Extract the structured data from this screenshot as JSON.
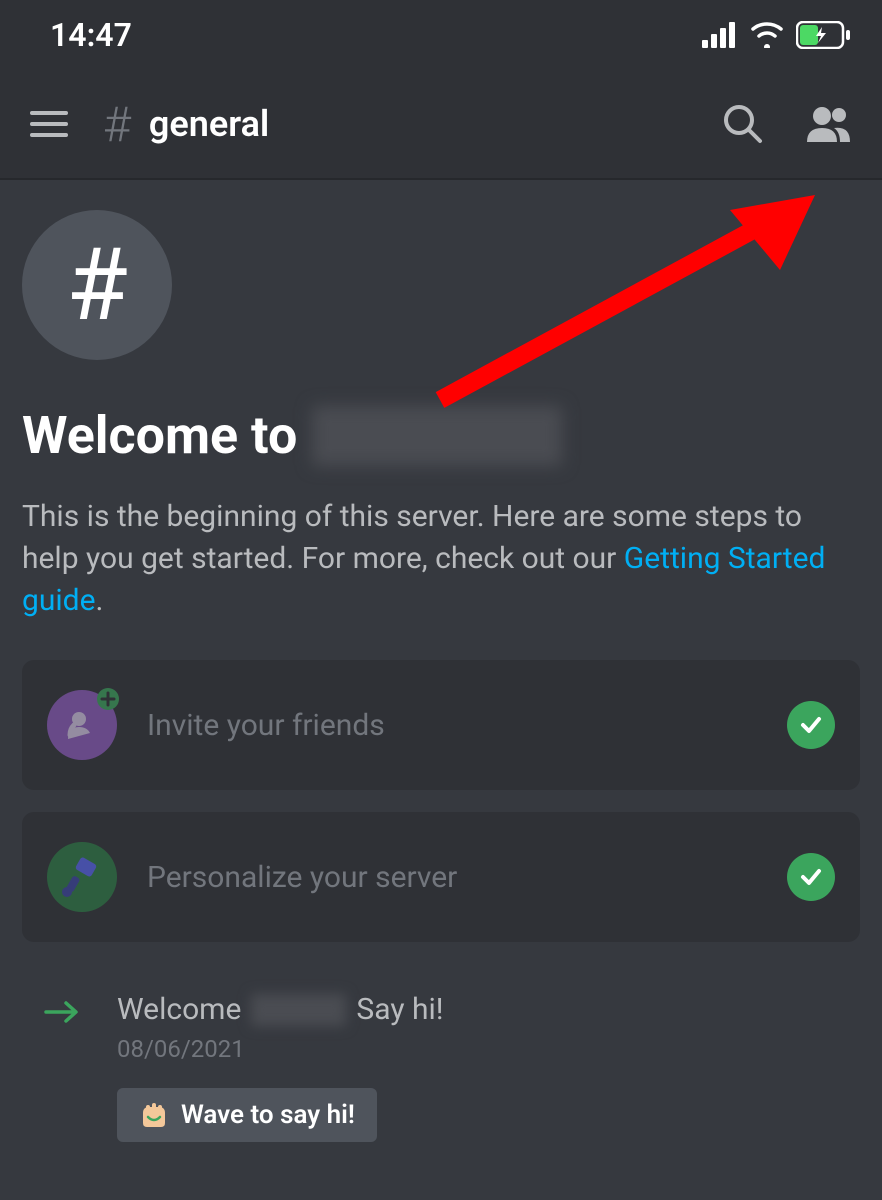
{
  "status": {
    "time": "14:47"
  },
  "header": {
    "channel_prefix": "#",
    "channel_name": "general"
  },
  "welcome": {
    "title_prefix": "Welcome to",
    "description_part1": "This is the beginning of this server. Here are some steps to help you get started. For more, check out our ",
    "link_text": "Getting Started guide",
    "description_part2": "."
  },
  "actions": {
    "invite": "Invite your friends",
    "personalize": "Personalize your server"
  },
  "system_message": {
    "text_before": "Welcome",
    "text_after": "Say hi!",
    "timestamp": "08/06/2021",
    "wave_label": "Wave to say hi!"
  }
}
